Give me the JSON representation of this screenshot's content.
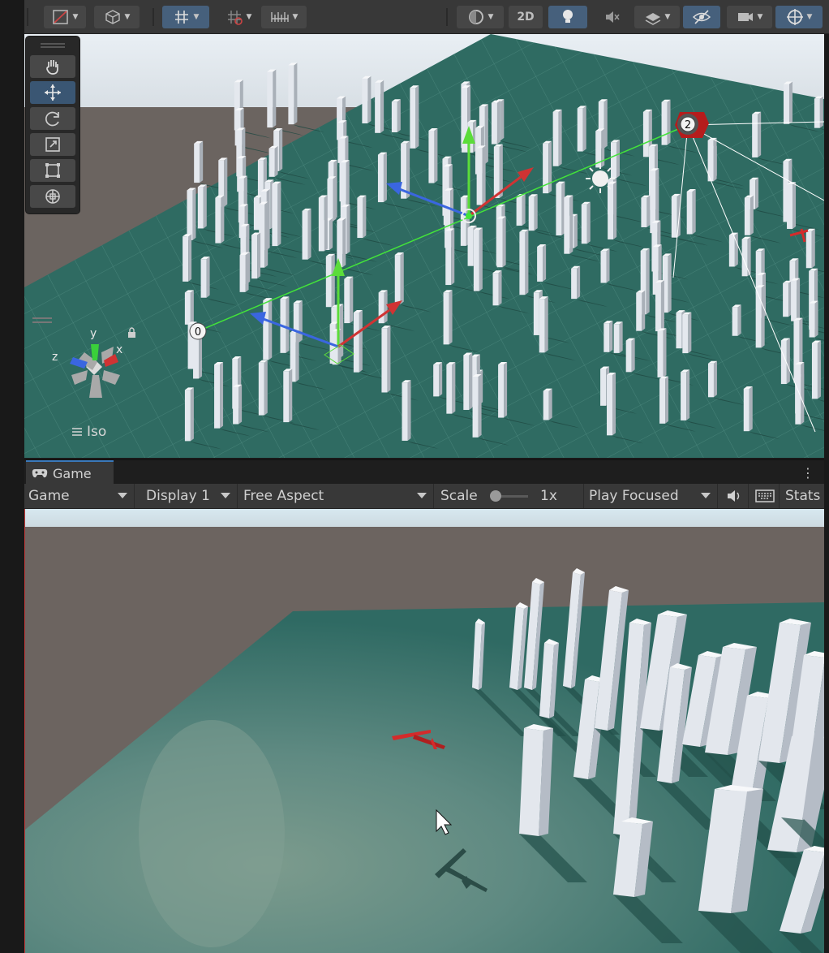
{
  "toolbar": {
    "mode_2d_label": "2D",
    "icons": [
      "draw-mode-icon",
      "shading-cube-icon",
      "grid-snap-icon",
      "increment-snap-icon",
      "ruler-icon",
      "render-mode-icon",
      "lighting-icon",
      "audio-mute-icon",
      "effects-layers-icon",
      "visibility-icon",
      "camera-icon",
      "gizmos-icon"
    ]
  },
  "tools": [
    "hand-tool-icon",
    "move-tool-icon",
    "rotate-tool-icon",
    "scale-tool-icon",
    "rect-tool-icon",
    "transform-tool-icon"
  ],
  "scene": {
    "projection_label": "Iso",
    "axis_labels": {
      "x": "x",
      "y": "y",
      "z": "z"
    },
    "waypoints": [
      "0",
      "2"
    ]
  },
  "game_panel": {
    "tab_label": "Game",
    "view_select": "Game",
    "display_select": "Display 1",
    "aspect_select": "Free Aspect",
    "scale_label": "Scale",
    "scale_value": "1x",
    "play_mode_select": "Play Focused",
    "stats_label": "Stats"
  },
  "colors": {
    "ground": "#2f6b62",
    "building": "#dde2ea",
    "horizon_brown": "#6e6761",
    "sky": "#cfe3ee",
    "accent_blue": "#3a79bb",
    "plane_red": "#d42b2b"
  }
}
